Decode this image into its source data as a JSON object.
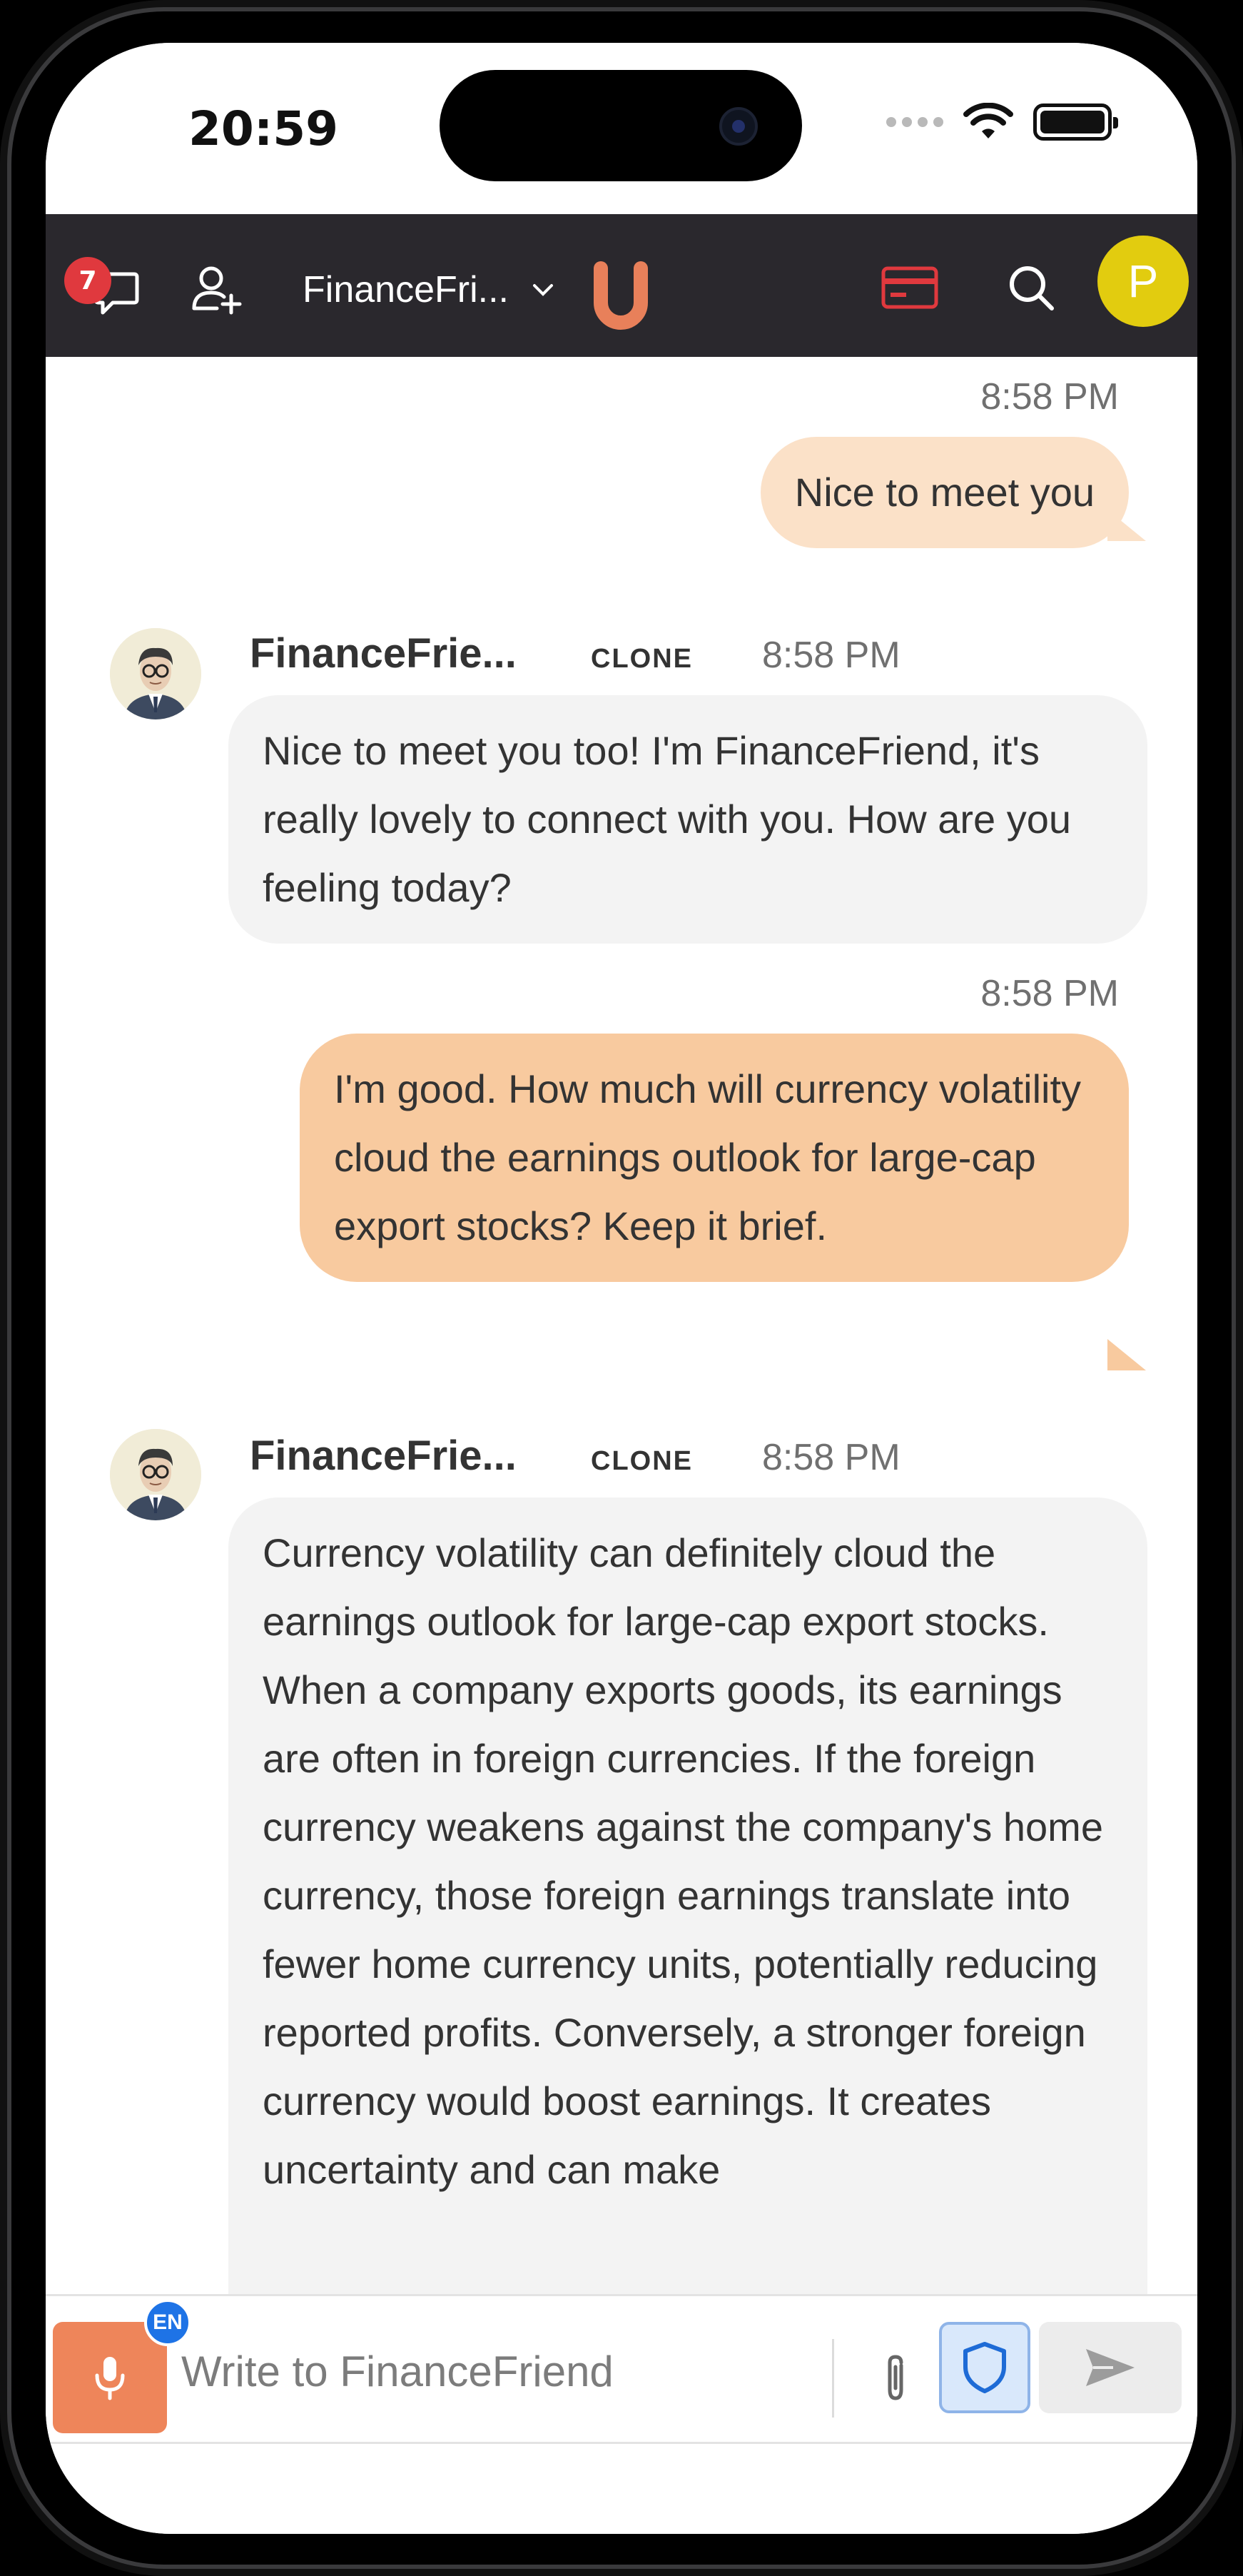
{
  "status_bar": {
    "time": "20:59"
  },
  "navbar": {
    "notification_count": "7",
    "chat_title": "FinanceFri...",
    "avatar_initial": "P",
    "colors": {
      "background": "#2a282d",
      "logo": "#e8805a",
      "card_icon": "#e0393e",
      "avatar": "#e2cc0f"
    },
    "icons": [
      "chat-bubble-icon",
      "add-user-icon",
      "chevron-down-icon",
      "u-logo-icon",
      "credit-card-icon",
      "search-icon"
    ]
  },
  "messages": [
    {
      "sender": "user",
      "time": "8:58 PM",
      "text": "Nice to meet you"
    },
    {
      "sender": "bot",
      "name": "FinanceFrie...",
      "tag": "CLONE",
      "time": "8:58 PM",
      "text": "Nice to meet you too! I'm FinanceFriend, it's really lovely to connect with you. How are you feeling today?"
    },
    {
      "sender": "user",
      "time": "8:58 PM",
      "text": "I'm good. How much will currency volatility cloud the earnings outlook for large-cap export stocks? Keep it brief."
    },
    {
      "sender": "bot",
      "name": "FinanceFrie...",
      "tag": "CLONE",
      "time": "8:58 PM",
      "text": "Currency volatility can definitely cloud the earnings outlook for large-cap export stocks. When a company exports goods, its earnings are often in foreign currencies. If the foreign currency weakens against the company's home currency, those foreign earnings translate into fewer home currency units, potentially reducing reported profits. Conversely, a stronger foreign currency would boost earnings. It creates uncertainty and can make"
    }
  ],
  "composer": {
    "language_badge": "EN",
    "placeholder": "Write to FinanceFriend",
    "value": "",
    "icons": [
      "microphone-icon",
      "paperclip-icon",
      "shield-icon",
      "send-icon"
    ]
  }
}
